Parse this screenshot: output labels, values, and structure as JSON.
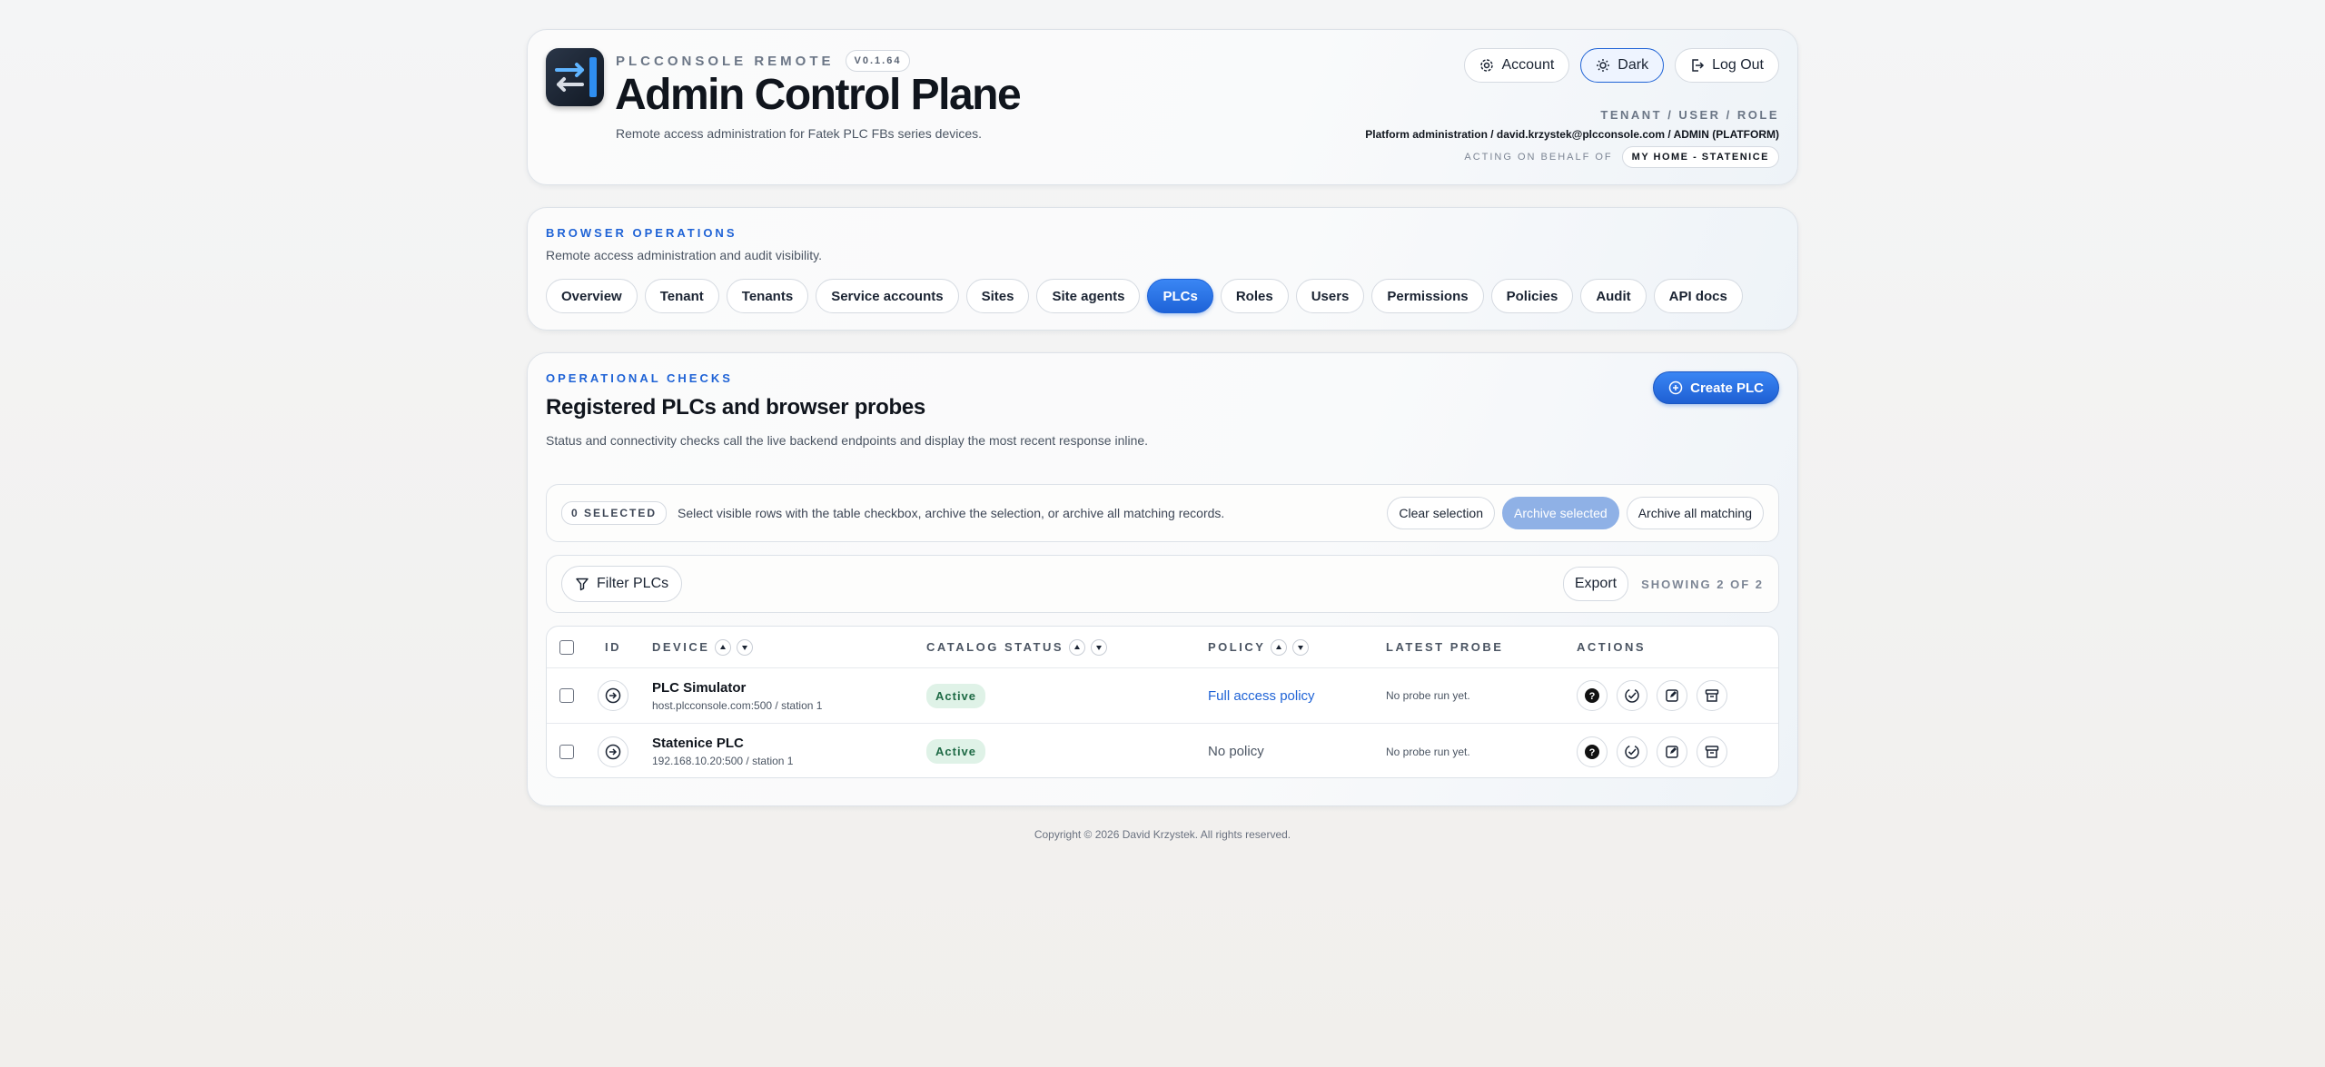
{
  "header": {
    "eyebrow": "PLCCONSOLE REMOTE",
    "version": "V0.1.64",
    "title": "Admin Control Plane",
    "subtitle": "Remote access administration for Fatek PLC FBs series devices.",
    "buttons": {
      "account": "Account",
      "dark": "Dark",
      "logout": "Log Out"
    },
    "meta_label": "TENANT / USER / ROLE",
    "meta_value": "Platform administration / david.krzystek@plcconsole.com / ADMIN (PLATFORM)",
    "behalf_label": "ACTING ON BEHALF OF",
    "behalf_value": "MY HOME - STATENICE"
  },
  "nav": {
    "eyebrow": "BROWSER OPERATIONS",
    "description": "Remote access administration and audit visibility.",
    "tabs": [
      "Overview",
      "Tenant",
      "Tenants",
      "Service accounts",
      "Sites",
      "Site agents",
      "PLCs",
      "Roles",
      "Users",
      "Permissions",
      "Policies",
      "Audit",
      "API docs"
    ],
    "active_tab": "PLCs"
  },
  "main": {
    "eyebrow": "OPERATIONAL CHECKS",
    "title": "Registered PLCs and browser probes",
    "description": "Status and connectivity checks call the live backend endpoints and display the most recent response inline.",
    "create_label": "Create PLC",
    "selection": {
      "badge": "0 SELECTED",
      "text": "Select visible rows with the table checkbox, archive the selection, or archive all matching records.",
      "clear": "Clear selection",
      "archive_selected": "Archive selected",
      "archive_all": "Archive all matching"
    },
    "filter": {
      "label": "Filter PLCs",
      "export": "Export",
      "showing": "SHOWING 2 OF 2"
    },
    "table": {
      "columns": {
        "id": "ID",
        "device": "DEVICE",
        "catalog_status": "CATALOG STATUS",
        "policy": "POLICY",
        "latest_probe": "LATEST PROBE",
        "actions": "ACTIONS"
      },
      "rows": [
        {
          "name": "PLC Simulator",
          "host": "host.plcconsole.com:500 / station 1",
          "status": "Active",
          "policy": "Full access policy",
          "probe": "No probe run yet."
        },
        {
          "name": "Statenice PLC",
          "host": "192.168.10.20:500 / station 1",
          "status": "Active",
          "policy": "No policy",
          "probe": "No probe run yet."
        }
      ]
    }
  },
  "footer": "Copyright © 2026 David Krzystek. All rights reserved.",
  "colors": {
    "accent": "#1f63d6",
    "active_badge_bg": "#dff2e7",
    "active_badge_text": "#1e6a45"
  }
}
